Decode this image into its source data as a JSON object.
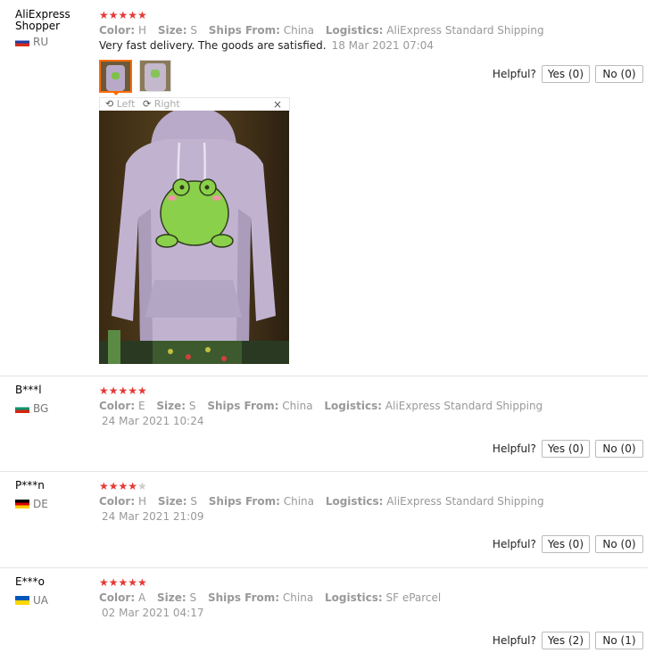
{
  "labels": {
    "color": "Color:",
    "size": "Size:",
    "ships_from": "Ships From:",
    "logistics": "Logistics:",
    "helpful": "Helpful?"
  },
  "viewer": {
    "left": "Left",
    "right": "Right",
    "close": "×"
  },
  "reviews": [
    {
      "name": "AliExpress Shopper",
      "country": "RU",
      "rating": 5,
      "stars": "★★★★★",
      "color": "H",
      "size": "S",
      "ships_from": "China",
      "logistics": "AliExpress Standard Shipping",
      "feedback": "Very fast delivery. The goods are satisfied.",
      "date": "18 Mar 2021 07:04",
      "yes": "Yes (0)",
      "no": "No (0)"
    },
    {
      "name": "B***l",
      "country": "BG",
      "rating": 5,
      "stars": "★★★★★",
      "color": "E",
      "size": "S",
      "ships_from": "China",
      "logistics": "AliExpress Standard Shipping",
      "date": "24 Mar 2021 10:24",
      "yes": "Yes (0)",
      "no": "No (0)"
    },
    {
      "name": "P***n",
      "country": "DE",
      "rating": 4,
      "stars": "★★★★",
      "stars_off": "★",
      "color": "H",
      "size": "S",
      "ships_from": "China",
      "logistics": "AliExpress Standard Shipping",
      "date": "24 Mar 2021 21:09",
      "yes": "Yes (0)",
      "no": "No (0)"
    },
    {
      "name": "E***o",
      "country": "UA",
      "rating": 5,
      "stars": "★★★★★",
      "color": "A",
      "size": "S",
      "ships_from": "China",
      "logistics": "SF eParcel",
      "date": "02 Mar 2021 04:17",
      "yes": "Yes (2)",
      "no": "No (1)"
    }
  ]
}
